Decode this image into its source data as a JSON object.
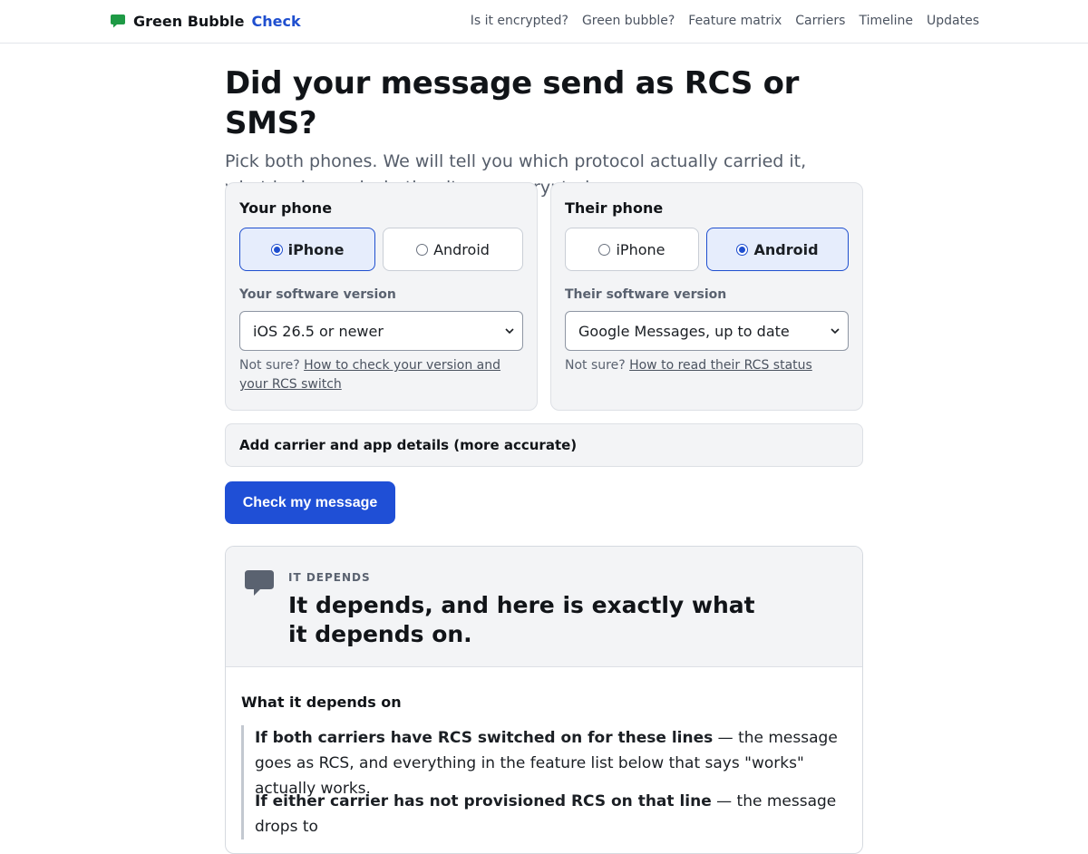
{
  "header": {
    "brand_main": "Green Bubble",
    "brand_accent": "Check",
    "brand_icon": "speech-bubble-icon",
    "brand_color": "#1e9a45",
    "nav": [
      "Is it encrypted?",
      "Green bubble?",
      "Feature matrix",
      "Carriers",
      "Timeline",
      "Updates"
    ]
  },
  "page": {
    "title": "Did your message send as RCS or SMS?",
    "lede": "Pick both phones. We will tell you which protocol actually carried it, what broke, and whether it was encrypted."
  },
  "your_phone": {
    "title": "Your phone",
    "options": [
      "iPhone",
      "Android"
    ],
    "selected": "iPhone",
    "version_label": "Your software version",
    "version_value": "iOS 26.5 or newer",
    "hint_prefix": "Not sure?",
    "hint_link": "How to check your version and your RCS switch"
  },
  "their_phone": {
    "title": "Their phone",
    "options": [
      "iPhone",
      "Android"
    ],
    "selected": "Android",
    "version_label": "Their software version",
    "version_value": "Google Messages, up to date",
    "hint_prefix": "Not sure?",
    "hint_link": "How to read their RCS status"
  },
  "details_label": "Add carrier and app details (more accurate)",
  "cta_label": "Check my message",
  "result": {
    "kicker": "IT DEPENDS",
    "verdict": "It depends, and here is exactly what it depends on.",
    "section_title": "What it depends on",
    "conditions": [
      {
        "lead": "If both carriers have RCS switched on for these lines",
        "text": " — the message goes as RCS, and everything in the feature list below that says \"works\" actually works."
      },
      {
        "lead": "If either carrier has not provisioned RCS on that line",
        "text": " — the message drops to"
      }
    ]
  },
  "colors": {
    "accent": "#1f4fd6",
    "selected_bg": "#e6edfc",
    "card_bg": "#f3f4f6"
  }
}
